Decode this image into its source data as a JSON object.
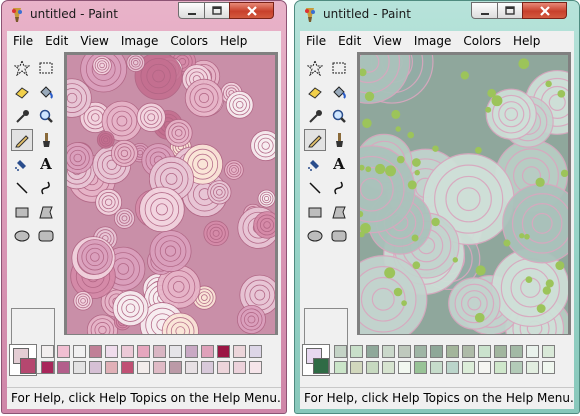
{
  "windows": [
    {
      "title": "untitled - Paint",
      "frame_color": "#d895b4",
      "painting": "pink succulents",
      "menu": [
        "File",
        "Edit",
        "View",
        "Image",
        "Colors",
        "Help"
      ],
      "status": "For Help, click Help Topics on the Help Menu.",
      "palette_colors": [
        "#f2eeee",
        "#f1bfd2",
        "#f1f0f1",
        "#c07f96",
        "#efdcec",
        "#ecc9d7",
        "#e6a6be",
        "#d9b6c3",
        "#e5e4e8",
        "#c9a9c4",
        "#dfa1ba",
        "#9b1644",
        "#ecd5da",
        "#ddd6e7",
        "#a8265a",
        "#b35e8b",
        "#e3e2e3",
        "#d6c0d5",
        "#e0b0b7",
        "#c05074",
        "#f3eceb",
        "#dfbbc6",
        "#bb9aa7",
        "#e7e0e4",
        "#d8c9da",
        "#edd5db",
        "#ecd2db",
        "#f6e5ea"
      ],
      "fg_color": "#e4cdd4",
      "bg_color": "#b5476f"
    },
    {
      "title": "untitled - Paint",
      "frame_color": "#96d3c7",
      "painting": "blue-green succulents",
      "menu": [
        "File",
        "Edit",
        "View",
        "Image",
        "Colors",
        "Help"
      ],
      "status": "For Help, click Help Topics on the Help Menu.",
      "palette_colors": [
        "#c4d3c6",
        "#c8dfc9",
        "#8fa89a",
        "#cad8ca",
        "#bfc9bd",
        "#9fb5a5",
        "#8ea798",
        "#a3b59b",
        "#aebba8",
        "#cae2cd",
        "#a2b69f",
        "#a2b9a5",
        "#e9f2ec",
        "#d9e9d8",
        "#cbe5c9",
        "#d2d8bd",
        "#c7d9c0",
        "#d7e4d0",
        "#f2f8f0",
        "#99c397",
        "#c6dccb",
        "#bbd5cb",
        "#dcedd9",
        "#f6f6f2",
        "#cfe7cb",
        "#b3cbb8",
        "#e2eee0",
        "#f0f7ef"
      ],
      "fg_color": "#e8d8f0",
      "bg_color": "#2f6b45"
    }
  ]
}
